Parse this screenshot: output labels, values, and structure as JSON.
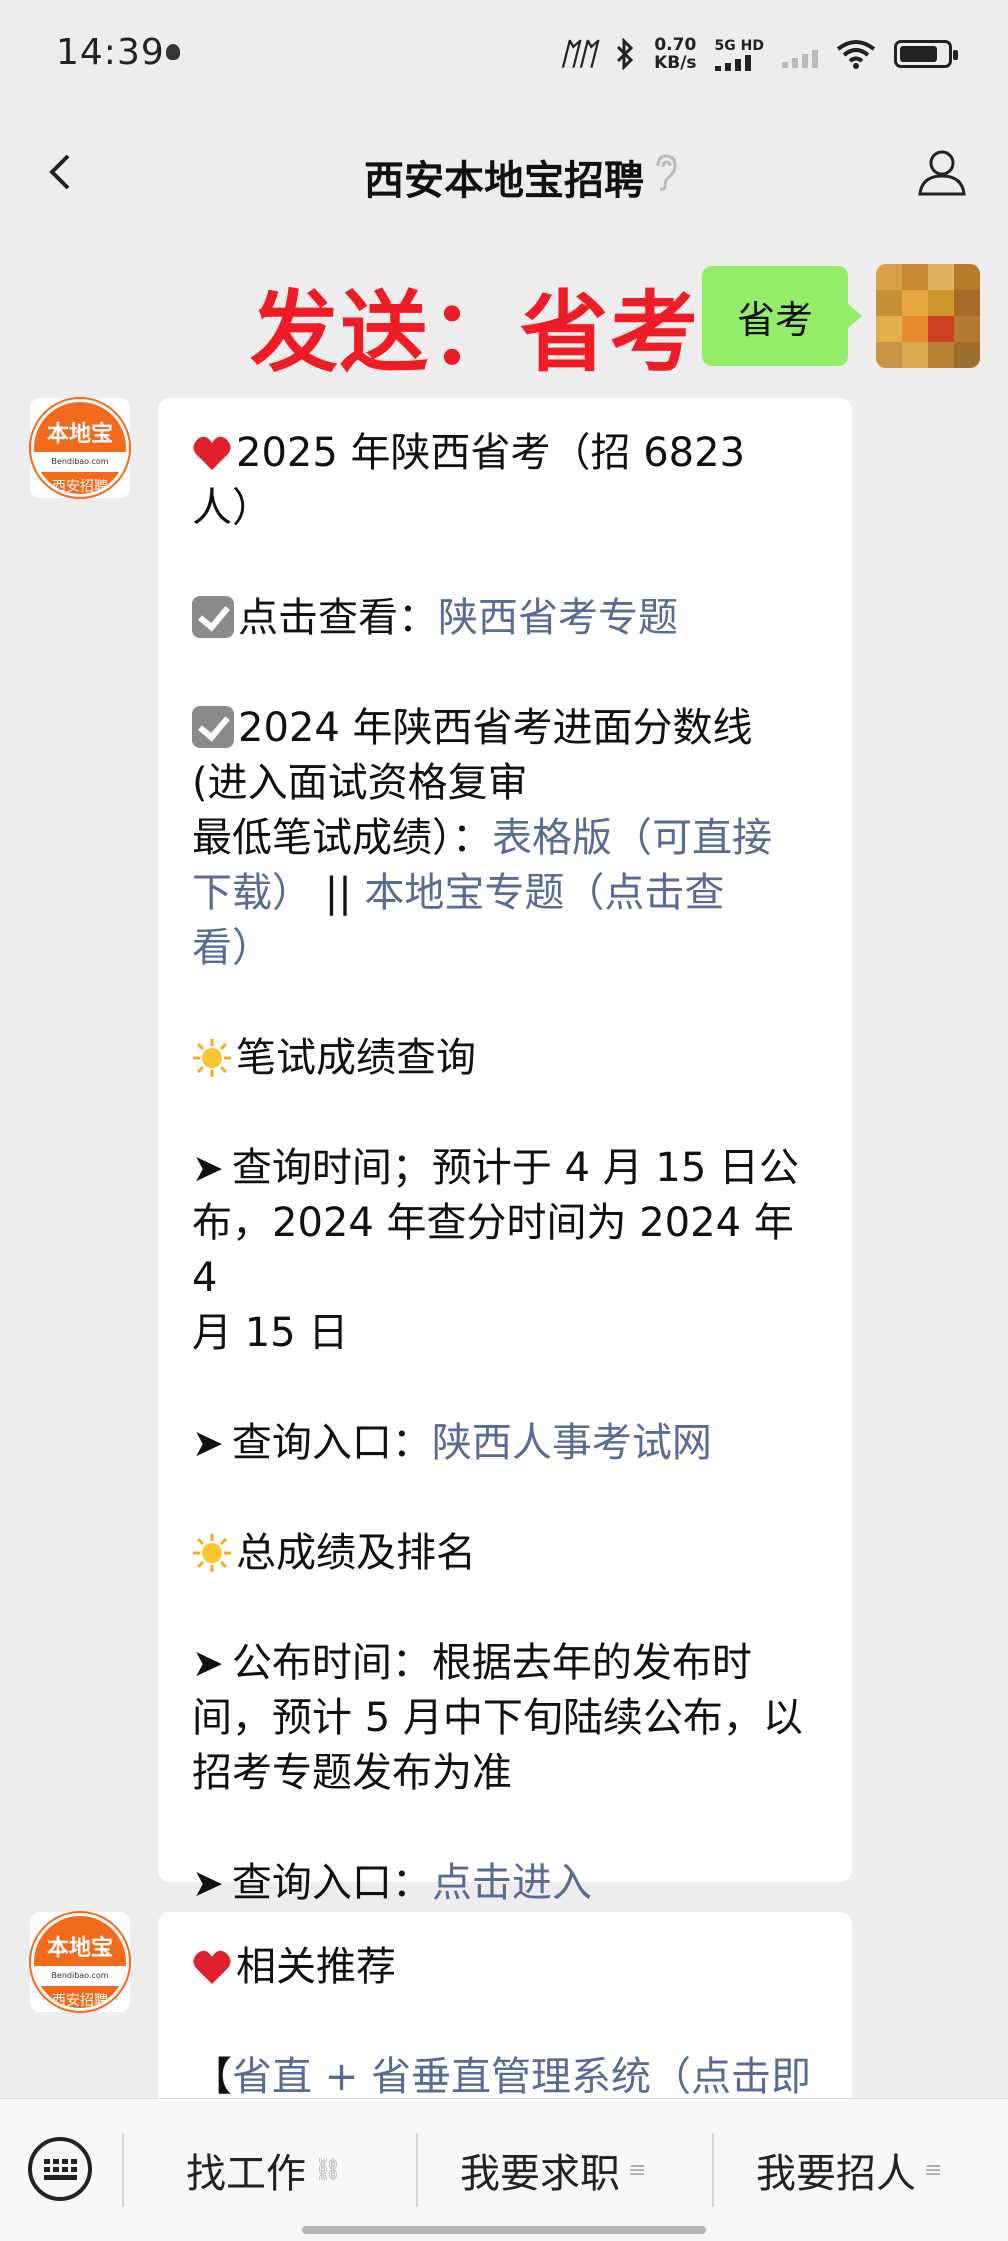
{
  "status_bar": {
    "time": "14:39",
    "net_speed_value": "0.70",
    "net_speed_unit": "KB/s",
    "signal_label": "5G HD",
    "carrier_icon": "carrier-logo-icon",
    "battery_level": 0.8
  },
  "nav": {
    "title": "西安本地宝招聘",
    "back_icon": "chevron-left-icon",
    "ear_icon": "ear-icon",
    "profile_icon": "person-icon"
  },
  "overlay": {
    "text": "发送：省考",
    "color": "#ee1c25"
  },
  "sent_message": {
    "text": "省考",
    "color": "#95ec69"
  },
  "bot": {
    "avatar_top": "本地宝",
    "avatar_mid": "Bendibao.com",
    "avatar_bottom": "西安招聘"
  },
  "message1": {
    "line1": "2025 年陕西省考（招 6823",
    "line2": "人）",
    "check1_prefix": "点击查看：",
    "check1_link": "陕西省考专题",
    "check2_line1": "2024 年陕西省考进面分数线",
    "check2_line2": "(进入面试资格复审",
    "check2_line3_prefix": "最低笔试成绩）：",
    "check2_line3_link": "表格版（可直接",
    "check2_line4_link_a": "下载）",
    "check2_line4_sep": " || ",
    "check2_line4_link_b": "本地宝专题（点击查",
    "check2_line5_link": "看）",
    "sun1_title": "笔试成绩查询",
    "time_line1": "查询时间；预计于 4 月 15 日公",
    "time_line2": "布，2024 年查分时间为 2024 年 4",
    "time_line3": "月 15 日",
    "entry1_prefix": "查询入口：",
    "entry1_link": "陕西人事考试网",
    "sun2_title": "总成绩及排名",
    "pub_line1": "公布时间：根据去年的发布时",
    "pub_line2": "间，预计 5 月中下旬陆续公布，以",
    "pub_line3": "招考专题发布为准",
    "entry2_prefix": "查询入口：",
    "entry2_link": "点击进入"
  },
  "message2": {
    "title": "相关推荐",
    "line1_bracket": "【",
    "line1_link": "省直 + 省垂直管理系统（点击即"
  },
  "bottom_menu": {
    "keyboard_icon": "keyboard-icon",
    "item1": "找工作",
    "item1_icon": "link-icon",
    "item2": "我要求职",
    "item2_icon": "menu-icon",
    "item3": "我要招人",
    "item3_icon": "menu-icon"
  },
  "colors": {
    "link": "#576b95",
    "background": "#ededed",
    "bubble": "#ffffff"
  }
}
